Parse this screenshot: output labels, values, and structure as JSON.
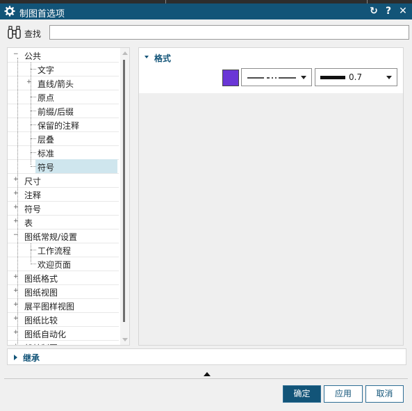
{
  "window": {
    "title": "制图首选项",
    "icons": [
      "gear-icon",
      "reset-icon",
      "help-icon",
      "close-icon"
    ],
    "accent_color": "#125478",
    "help_glyph": "?",
    "close_glyph": "✕",
    "reset_glyph": "↻"
  },
  "find": {
    "label": "查找",
    "value": ""
  },
  "tree": {
    "items": [
      {
        "label": "公共",
        "expander": "−"
      },
      {
        "label": "文字",
        "expander": ""
      },
      {
        "label": "直线/箭头",
        "expander": "+"
      },
      {
        "label": "原点",
        "expander": ""
      },
      {
        "label": "前缀/后缀",
        "expander": ""
      },
      {
        "label": "保留的注释",
        "expander": ""
      },
      {
        "label": "层叠",
        "expander": ""
      },
      {
        "label": "标准",
        "expander": ""
      },
      {
        "label": "符号",
        "expander": ""
      },
      {
        "label": "尺寸",
        "expander": "+"
      },
      {
        "label": "注释",
        "expander": "+"
      },
      {
        "label": "符号",
        "expander": "+"
      },
      {
        "label": "表",
        "expander": "+"
      },
      {
        "label": "图纸常规/设置",
        "expander": "−"
      },
      {
        "label": "工作流程",
        "expander": ""
      },
      {
        "label": "欢迎页面",
        "expander": ""
      },
      {
        "label": "图纸格式",
        "expander": "+"
      },
      {
        "label": "图纸视图",
        "expander": "+"
      },
      {
        "label": "展平图样视图",
        "expander": "+"
      },
      {
        "label": "图纸比较",
        "expander": "+"
      },
      {
        "label": "图纸自动化",
        "expander": "+"
      },
      {
        "label": "船舶制图",
        "expander": "+"
      }
    ],
    "selected": "符号"
  },
  "format": {
    "header": "格式",
    "color": "#6a36d6",
    "line_font": "dash-dot-dot",
    "line_width": "0.7"
  },
  "inherit": {
    "header": "继承"
  },
  "buttons": {
    "ok": "确定",
    "apply": "应用",
    "cancel": "取消"
  }
}
